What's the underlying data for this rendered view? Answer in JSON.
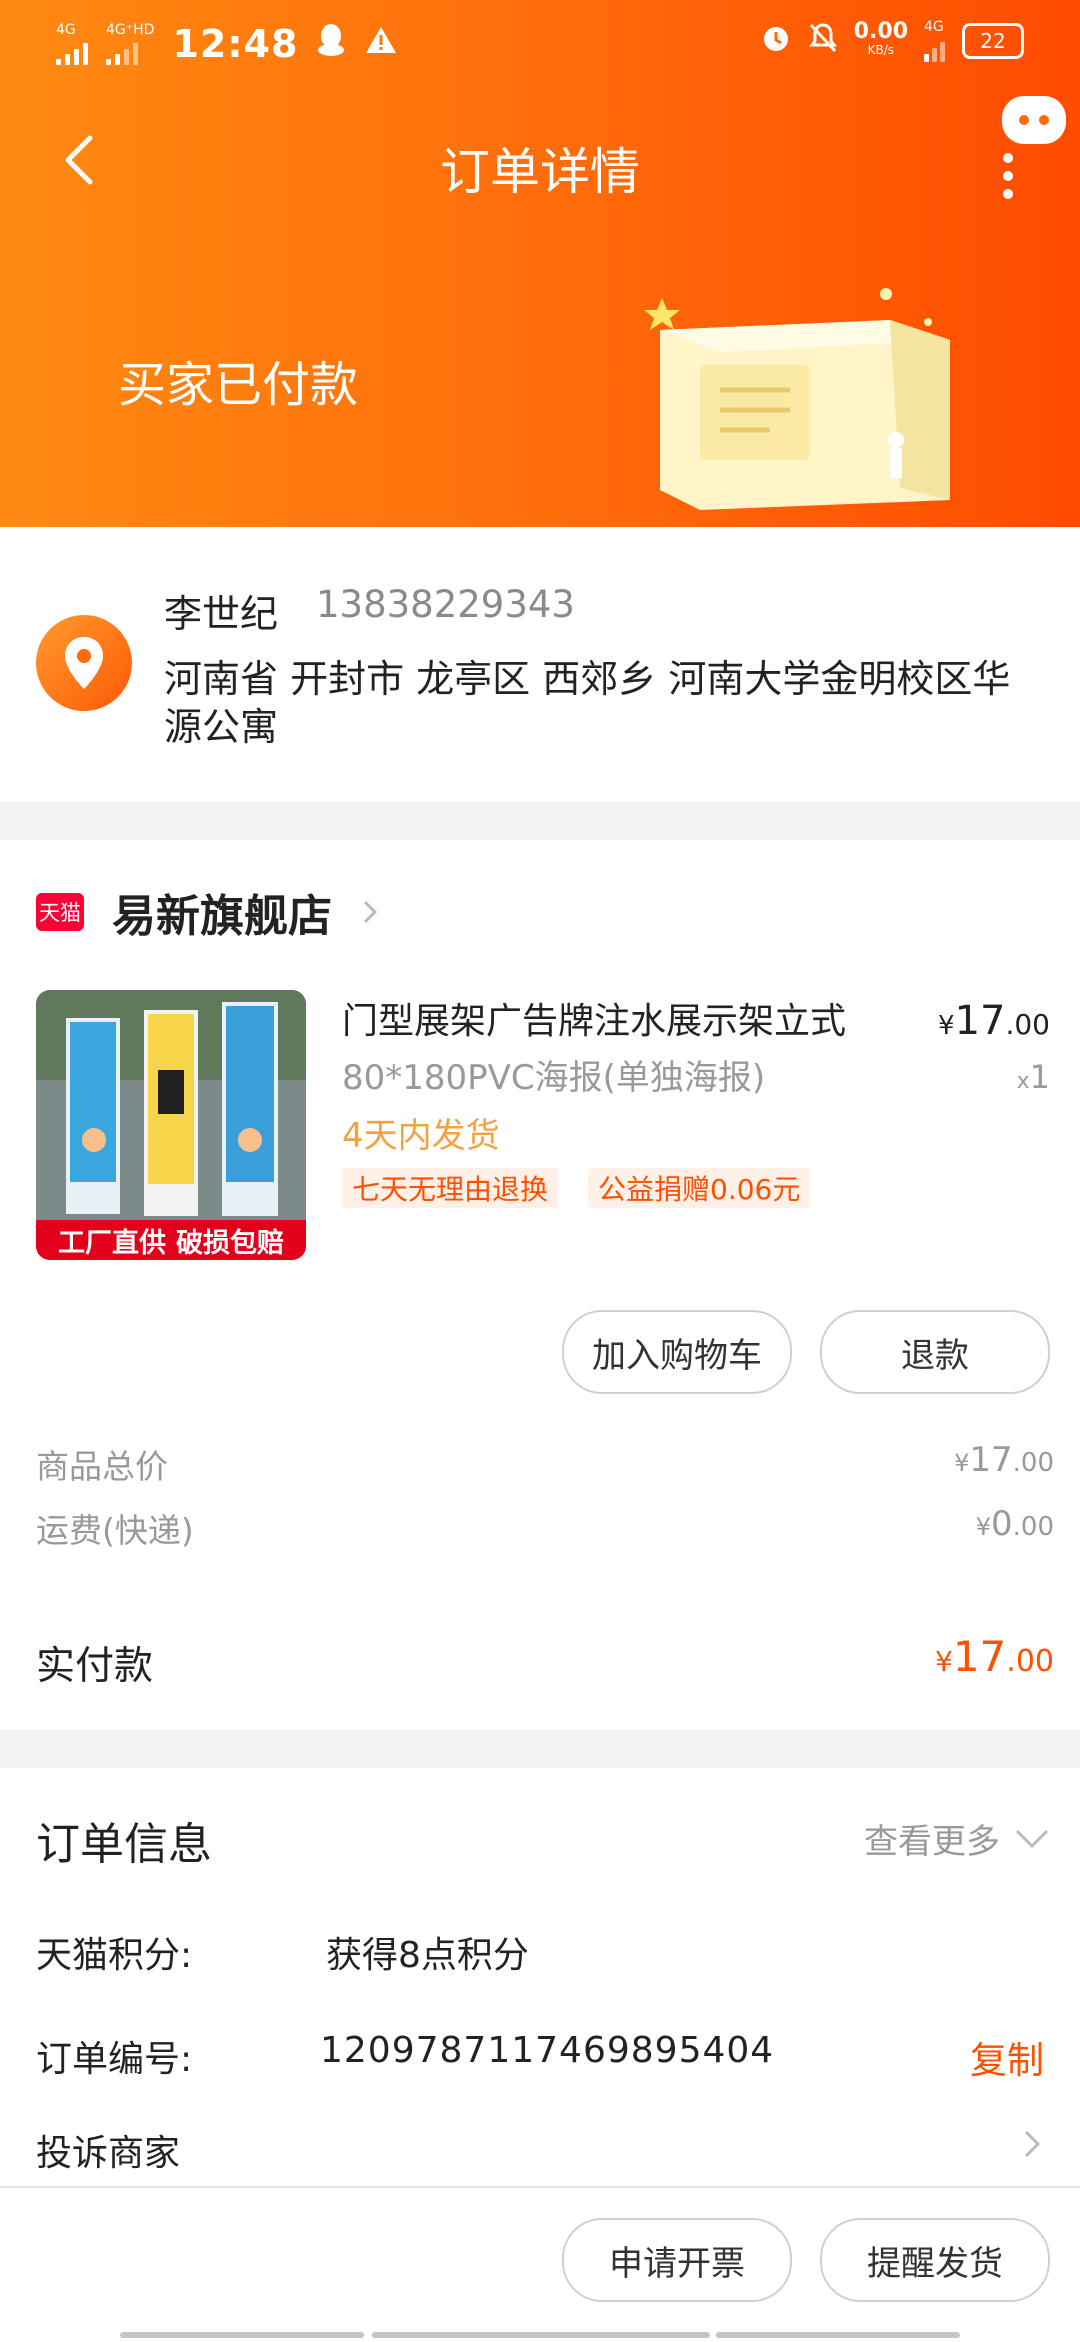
{
  "status_bar": {
    "sig1_label": "4G",
    "sig2_label": "4G⁺HD",
    "time": "12:48",
    "speed_value": "0.00",
    "speed_unit": "KB/s",
    "sig3_label": "4G",
    "battery": "22"
  },
  "nav": {
    "title": "订单详情"
  },
  "banner": {
    "status_text": "买家已付款"
  },
  "address": {
    "name": "李世纪",
    "phone": "13838229343",
    "full_address": "河南省 开封市 龙亭区 西郊乡 河南大学金明校区华源公寓"
  },
  "shop": {
    "badge": "天猫",
    "name": "易新旗舰店"
  },
  "product": {
    "title": "门型展架广告牌注水展示架立式",
    "sku": "80*180PVC海报(单独海报)",
    "ship_time": "4天内发货",
    "tags": [
      "七天无理由退换",
      "公益捐赠0.06元"
    ],
    "price_currency": "¥",
    "price_int": "17",
    "price_dec": ".00",
    "qty_prefix": "x",
    "qty": "1",
    "image_band_left": "工厂直供",
    "image_band_right": "破损包赔"
  },
  "item_actions": {
    "add_cart": "加入购物车",
    "refund": "退款"
  },
  "summary": {
    "goods_total_label": "商品总价",
    "goods_total_int": "17",
    "goods_total_dec": ".00",
    "shipping_label": "运费(快递)",
    "shipping_int": "0",
    "shipping_dec": ".00",
    "currency": "¥",
    "paid_label": "实付款",
    "paid_int": "17",
    "paid_dec": ".00"
  },
  "order_info": {
    "title": "订单信息",
    "view_more": "查看更多",
    "points_label": "天猫积分:",
    "points_value": "获得8点积分",
    "order_no_label": "订单编号:",
    "order_no": "1209787117469895404",
    "copy": "复制",
    "complain": "投诉商家"
  },
  "bottom_actions": {
    "invoice": "申请开票",
    "remind": "提醒发货"
  },
  "colors": {
    "accent": "#ff5000",
    "header_from": "#ff8a12",
    "header_to": "#ff4b00",
    "tmall_red": "#ff0036",
    "ship_orange": "#f3a33d"
  }
}
